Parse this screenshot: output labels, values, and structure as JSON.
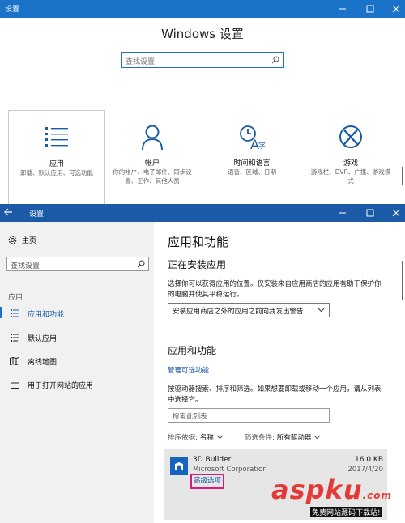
{
  "top_window": {
    "title": "设置",
    "heading": "Windows 设置",
    "search_placeholder": "查找设置",
    "categories": [
      {
        "label": "应用",
        "desc": "卸载、默认应用、可选功能",
        "icon": "apps-list-icon"
      },
      {
        "label": "帐户",
        "desc": "你的帐户、电子邮件、同步设置、工作、其他人员",
        "icon": "person-icon"
      },
      {
        "label": "时间和语言",
        "desc": "语音、区域、日期",
        "icon": "time-language-icon"
      },
      {
        "label": "游戏",
        "desc": "游戏栏、DVR、广播、游戏模式",
        "icon": "xbox-icon"
      }
    ]
  },
  "bottom_window": {
    "title": "设置",
    "sidebar": {
      "home_label": "主页",
      "search_placeholder": "查找设置",
      "section_label": "应用",
      "items": [
        {
          "label": "应用和功能",
          "icon": "apps-features-icon",
          "selected": true
        },
        {
          "label": "默认应用",
          "icon": "default-apps-icon"
        },
        {
          "label": "离线地图",
          "icon": "offline-maps-icon"
        },
        {
          "label": "用于打开网站的应用",
          "icon": "website-apps-icon"
        }
      ]
    },
    "content": {
      "title": "应用和功能",
      "installing_title": "正在安装应用",
      "installing_desc": "选择你可以获得应用的位置。仅安装来自应用商店的应用有助于保护你的电脑并使其平稳运行。",
      "source_select_value": "安装应用商店之外的应用之前向我发出警告",
      "apps_title": "应用和功能",
      "manage_optional_link": "管理可选功能",
      "apps_desc": "按驱动器搜索、排序和筛选。如果想要卸载或移动一个应用，请从列表中选择它。",
      "list_search_placeholder": "搜索此列表",
      "sort_label": "排序依据:",
      "sort_value": "名称",
      "filter_label": "筛选条件:",
      "filter_value": "所有驱动器",
      "app": {
        "name": "3D Builder",
        "company": "Microsoft Corporation",
        "size": "16.0 KB",
        "date": "2017/4/20",
        "advanced_link": "高级选项"
      }
    }
  },
  "watermark": {
    "logo_text": "aspku",
    "logo_suffix": ".com",
    "sub_text": "免费网站源码下载站!"
  },
  "colors": {
    "titlebar_top": "#1a73c8",
    "titlebar_bottom": "#1a5aa6",
    "accent": "#1a73c8",
    "highlight_box": "#d81b7a"
  }
}
